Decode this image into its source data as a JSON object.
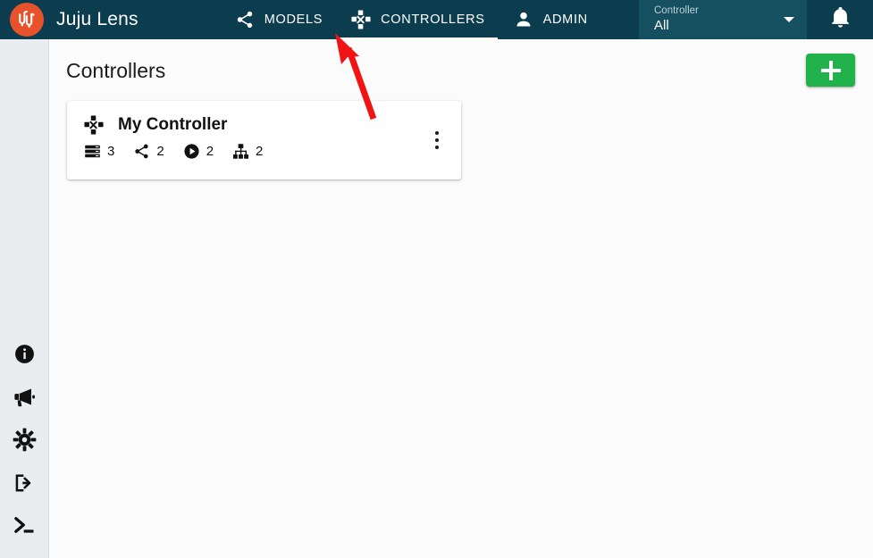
{
  "app": {
    "brand_title": "Juju Lens",
    "logo_icon": "juju-logo-icon",
    "accent_orange": "#e8522a",
    "header_bg": "#0b3d4e",
    "dropdown_bg": "#14505f",
    "add_button_green": "#21b24b",
    "annotation_arrow_color": "#f11414"
  },
  "header": {
    "nav": [
      {
        "label": "MODELS",
        "icon": "share-icon",
        "active": false
      },
      {
        "label": "CONTROLLERS",
        "icon": "controller-icon",
        "active": true
      },
      {
        "label": "ADMIN",
        "icon": "person-icon",
        "active": false
      }
    ],
    "controller_select": {
      "label": "Controller",
      "value": "All",
      "caret_icon": "chevron-down-icon"
    },
    "notifications_icon": "bell-icon"
  },
  "sidebar": {
    "items": [
      {
        "icon": "info-icon",
        "name": "info"
      },
      {
        "icon": "megaphone-icon",
        "name": "announcements"
      },
      {
        "icon": "gear-icon",
        "name": "settings"
      },
      {
        "icon": "logout-icon",
        "name": "logout"
      },
      {
        "icon": "terminal-icon",
        "name": "terminal"
      }
    ]
  },
  "main": {
    "page_title": "Controllers",
    "add_button": {
      "label": "+",
      "icon": "plus-icon"
    },
    "cards": [
      {
        "icon": "controller-icon",
        "title": "My Controller",
        "menu_icon": "kebab-menu-icon",
        "stats": [
          {
            "icon": "models-stack-icon",
            "value": "3"
          },
          {
            "icon": "share-icon",
            "value": "2"
          },
          {
            "icon": "play-circle-icon",
            "value": "2"
          },
          {
            "icon": "units-icon",
            "value": "2"
          }
        ]
      }
    ]
  }
}
